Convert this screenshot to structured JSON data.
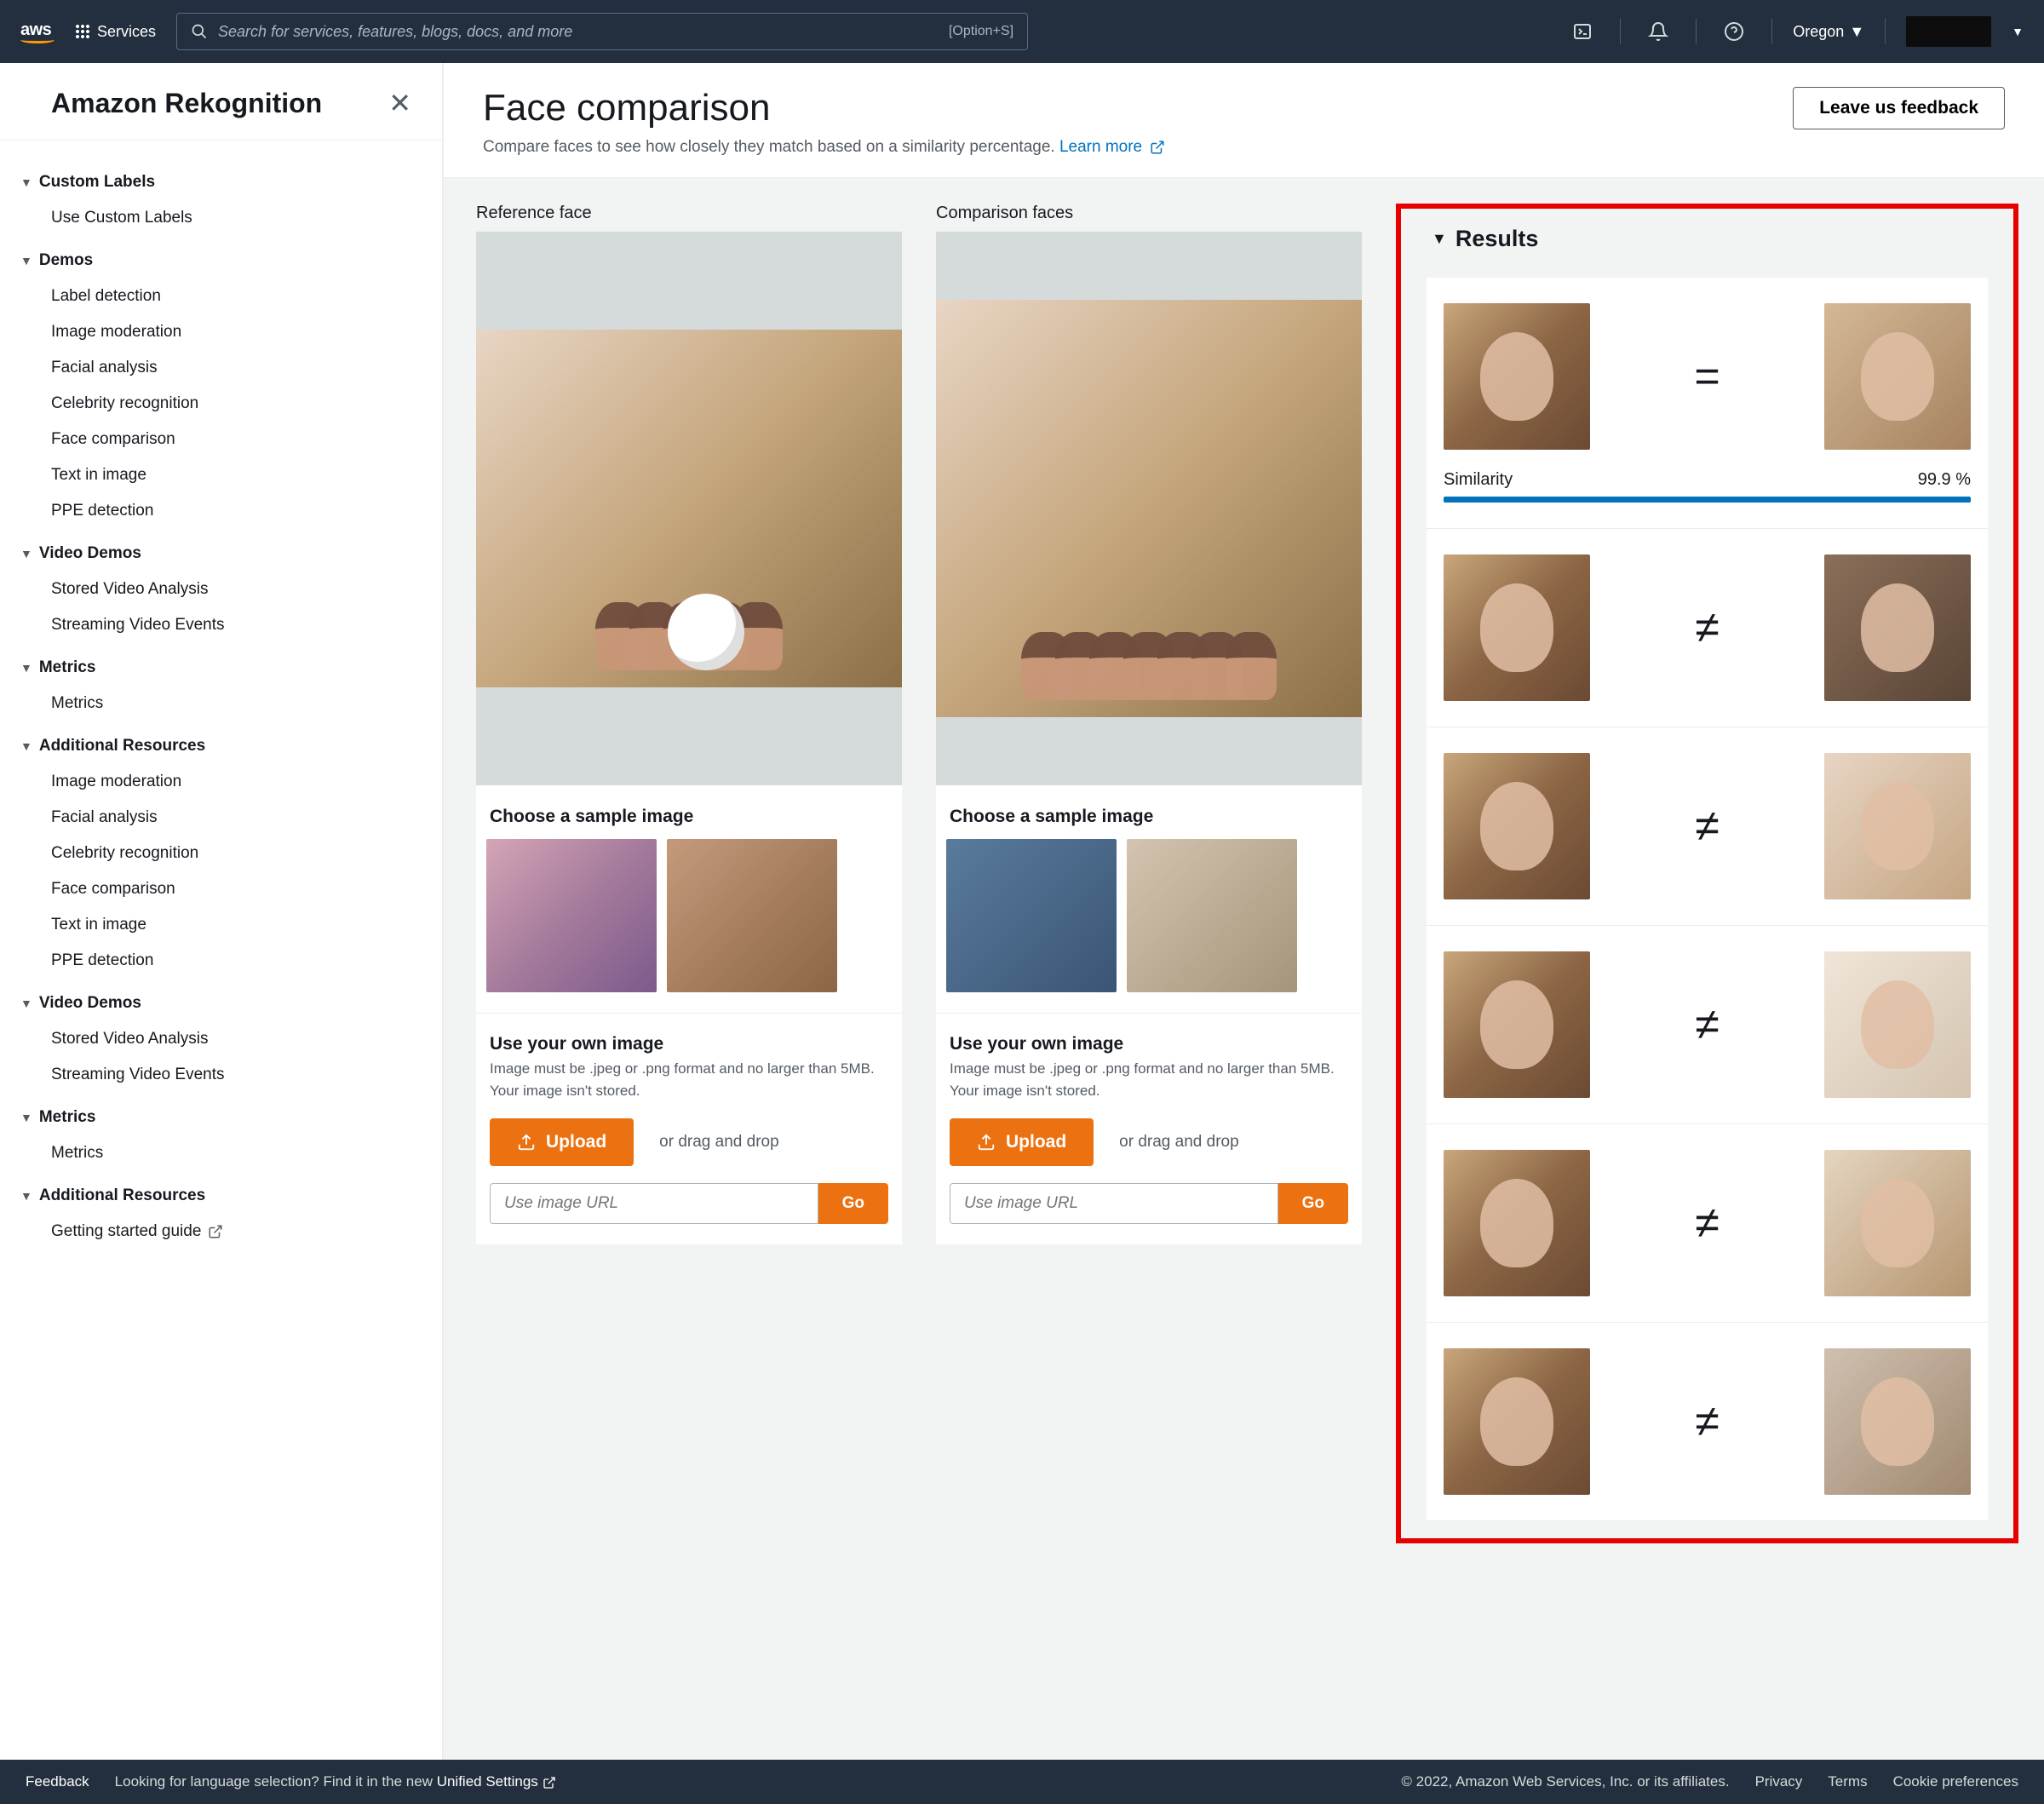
{
  "topnav": {
    "logo": "aws",
    "services": "Services",
    "search_placeholder": "Search for services, features, blogs, docs, and more",
    "shortcut": "[Option+S]",
    "region": "Oregon"
  },
  "sidebar": {
    "title": "Amazon Rekognition",
    "sections": [
      {
        "title": "Custom Labels",
        "items": [
          "Use Custom Labels"
        ]
      },
      {
        "title": "Demos",
        "items": [
          "Label detection",
          "Image moderation",
          "Facial analysis",
          "Celebrity recognition",
          "Face comparison",
          "Text in image",
          "PPE detection"
        ]
      },
      {
        "title": "Video Demos",
        "items": [
          "Stored Video Analysis",
          "Streaming Video Events"
        ]
      },
      {
        "title": "Metrics",
        "items": [
          "Metrics"
        ]
      },
      {
        "title": "Additional Resources",
        "items": [
          "Image moderation",
          "Facial analysis",
          "Celebrity recognition",
          "Face comparison",
          "Text in image",
          "PPE detection"
        ]
      },
      {
        "title": "Video Demos",
        "items": [
          "Stored Video Analysis",
          "Streaming Video Events"
        ]
      },
      {
        "title": "Metrics",
        "items": [
          "Metrics"
        ]
      },
      {
        "title": "Additional Resources",
        "items_ext": [
          {
            "label": "Getting started guide",
            "external": true
          }
        ]
      }
    ]
  },
  "page": {
    "title": "Face comparison",
    "subtitle": "Compare faces to see how closely they match based on a similarity percentage.",
    "learn_more": "Learn more",
    "feedback_btn": "Leave us feedback"
  },
  "columns": {
    "reference_label": "Reference face",
    "comparison_label": "Comparison faces",
    "choose_sample": "Choose a sample image",
    "own_title": "Use your own image",
    "own_note": "Image must be .jpeg or .png format and no larger than 5MB. Your image isn't stored.",
    "upload": "Upload",
    "drag": "or drag and drop",
    "url_placeholder": "Use image URL",
    "go": "Go"
  },
  "results": {
    "title": "Results",
    "similarity_label": "Similarity",
    "rows": [
      {
        "match": true,
        "similarity": "99.9 %"
      },
      {
        "match": false
      },
      {
        "match": false
      },
      {
        "match": false
      },
      {
        "match": false
      },
      {
        "match": false
      }
    ]
  },
  "footer": {
    "feedback": "Feedback",
    "lang_text": "Looking for language selection? Find it in the new ",
    "unified": "Unified Settings",
    "copyright": "© 2022, Amazon Web Services, Inc. or its affiliates.",
    "privacy": "Privacy",
    "terms": "Terms",
    "cookie": "Cookie preferences"
  }
}
